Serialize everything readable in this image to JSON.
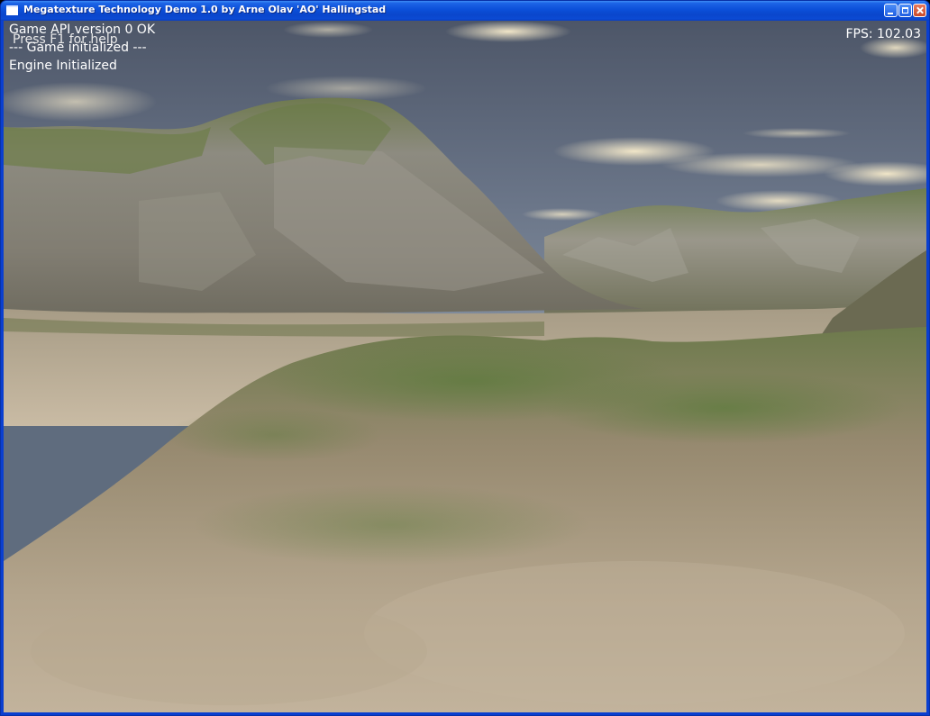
{
  "window": {
    "title": "Megatexture Technology Demo 1.0 by Arne Olav 'AO' Hallingstad",
    "icon": "app-window-icon",
    "controls": [
      "minimize-icon",
      "maximize-icon",
      "close-icon"
    ]
  },
  "console": {
    "lines": [
      "Game API version 0 OK",
      "Press F1 for help",
      "--- Game initialized ---",
      "Engine Initialized"
    ]
  },
  "hud": {
    "fps_label": "FPS: 102.03"
  },
  "colors": {
    "titlebar": "#0b4fd8",
    "sky": "#5f6c7e",
    "sand": "#b9a88f",
    "grass": "#5f7a3d",
    "rock": "#8f8c80"
  }
}
